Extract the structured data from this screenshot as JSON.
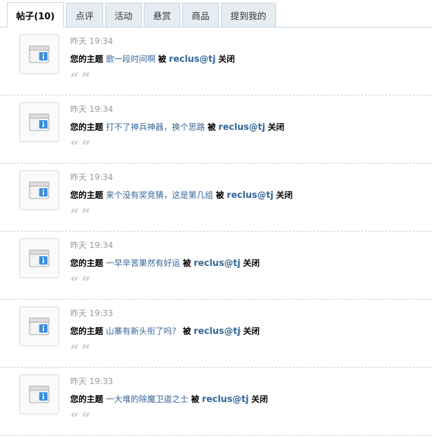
{
  "tabs": [
    {
      "label": "帖子(10)",
      "active": true
    },
    {
      "label": "点评",
      "active": false
    },
    {
      "label": "活动",
      "active": false
    },
    {
      "label": "悬赏",
      "active": false
    },
    {
      "label": "商品",
      "active": false
    },
    {
      "label": "提到我的",
      "active": false
    }
  ],
  "notices": [
    {
      "time": "昨天 19:34",
      "prefix": "您的主题",
      "thread": "歌一段时间啊",
      "by": "被",
      "user": "reclus@tj",
      "action": "关闭",
      "quote_open": "“",
      "quote_close": "”",
      "icon": "notice-info-icon"
    },
    {
      "time": "昨天 19:34",
      "prefix": "您的主题",
      "thread": "打不了神兵神器，换个思路",
      "by": "被",
      "user": "reclus@tj",
      "action": "关闭",
      "quote_open": "“",
      "quote_close": "”",
      "icon": "notice-info-icon"
    },
    {
      "time": "昨天 19:34",
      "prefix": "您的主题",
      "thread": "来个没有奖竞猜，这是第几组",
      "by": "被",
      "user": "reclus@tj",
      "action": "关闭",
      "quote_open": "“",
      "quote_close": "”",
      "icon": "notice-info-icon"
    },
    {
      "time": "昨天 19:34",
      "prefix": "您的主题",
      "thread": "一早辛苦果然有好运",
      "by": "被",
      "user": "reclus@tj",
      "action": "关闭",
      "quote_open": "“",
      "quote_close": "”",
      "icon": "notice-info-icon"
    },
    {
      "time": "昨天 19:33",
      "prefix": "您的主题",
      "thread": "山寨有新头衔了吗？",
      "by": "被",
      "user": "reclus@tj",
      "action": "关闭",
      "quote_open": "“",
      "quote_close": "”",
      "icon": "notice-info-icon"
    },
    {
      "time": "昨天 19:33",
      "prefix": "您的主题",
      "thread": "一大堆的除魔卫道之士",
      "by": "被",
      "user": "reclus@tj",
      "action": "关闭",
      "quote_open": "“",
      "quote_close": "”",
      "icon": "notice-info-icon"
    }
  ]
}
